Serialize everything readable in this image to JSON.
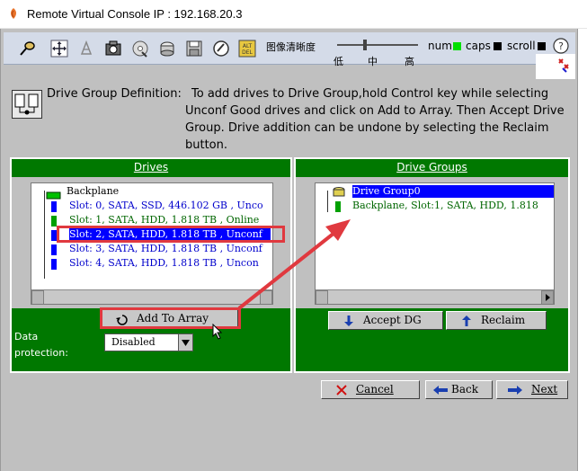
{
  "window": {
    "title": "Remote Virtual Console   IP : 192.168.20.3"
  },
  "toolbar": {
    "icons": [
      "pin-icon",
      "move-icon",
      "mouse-icon",
      "camera-icon",
      "cdrom-icon",
      "disk-icon",
      "floppy-icon",
      "power-icon",
      "keyboard-macro-icon"
    ],
    "quality_label": "图像清晰度",
    "quality_ticks": [
      "低",
      "中",
      "高"
    ],
    "quality_level": "低",
    "locks": [
      {
        "label": "num",
        "state": "on",
        "color": "#00e000"
      },
      {
        "label": "caps",
        "state": "off",
        "color": "#000000"
      },
      {
        "label": "scroll",
        "state": "off",
        "color": "#000000"
      }
    ],
    "help_label": "?"
  },
  "header": {
    "label": "Drive Group Definition:",
    "instructions": [
      "To add drives to Drive Group,hold Control key while selecting",
      "Unconf Good drives and click on Add to Array. Then Accept Drive",
      "Group. Drive addition can be undone by selecting the Reclaim",
      "button."
    ]
  },
  "drives_panel": {
    "title": "Drives",
    "root": "Backplane",
    "items": [
      {
        "label": "Slot: 0, SATA, SSD, 446.102 GB , Unco",
        "selected": false,
        "color": "blue"
      },
      {
        "label": "Slot: 1, SATA, HDD, 1.818 TB , Online",
        "selected": false,
        "color": "green"
      },
      {
        "label": "Slot: 2, SATA, HDD, 1.818 TB , Unconf",
        "selected": true,
        "color": "blue"
      },
      {
        "label": "Slot: 3, SATA, HDD, 1.818 TB , Unconf",
        "selected": false,
        "color": "blue"
      },
      {
        "label": "Slot: 4, SATA, HDD, 1.818 TB , Uncon",
        "selected": false,
        "color": "blue"
      }
    ],
    "add_button": "Add To Array",
    "protection_label_1": "Data",
    "protection_label_2": "protection:",
    "protection_value": "Disabled"
  },
  "groups_panel": {
    "title": "Drive Groups",
    "group": "Drive Group0",
    "member": "Backplane, Slot:1, SATA, HDD, 1.818",
    "accept_button": "Accept DG",
    "reclaim_button": "Reclaim"
  },
  "footer": {
    "cancel": "Cancel",
    "back": "Back",
    "next": "Next"
  },
  "colors": {
    "panel_green": "#007800",
    "selection_blue": "#0000ff",
    "annotation_red": "#e0393f"
  }
}
